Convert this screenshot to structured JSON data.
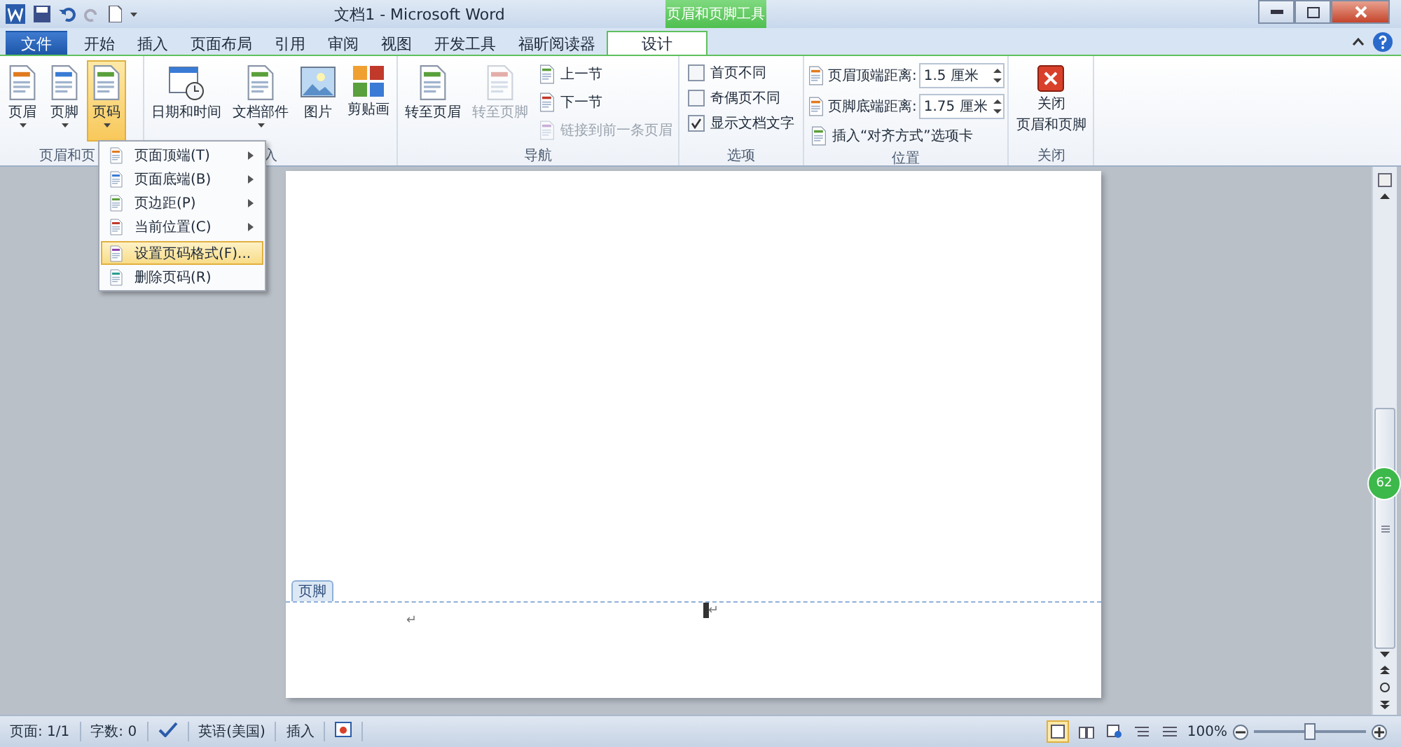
{
  "window": {
    "title": "文档1 - Microsoft Word",
    "contextual_header": "页眉和页脚工具"
  },
  "tabs": [
    {
      "label": "文件",
      "kind": "file",
      "selected": false
    },
    {
      "label": "开始",
      "kind": "tab",
      "selected": false
    },
    {
      "label": "插入",
      "kind": "tab",
      "selected": false
    },
    {
      "label": "页面布局",
      "kind": "tab",
      "selected": false
    },
    {
      "label": "引用",
      "kind": "tab",
      "selected": false
    },
    {
      "label": "审阅",
      "kind": "tab",
      "selected": false
    },
    {
      "label": "视图",
      "kind": "tab",
      "selected": false
    },
    {
      "label": "开发工具",
      "kind": "tab",
      "selected": false
    },
    {
      "label": "福昕阅读器",
      "kind": "tab",
      "selected": false
    },
    {
      "label": "设计",
      "kind": "contextual",
      "selected": true
    }
  ],
  "ribbon": {
    "groups": [
      {
        "label": "页眉和页",
        "items": [
          {
            "kind": "large",
            "label": "页眉",
            "dropdown": true,
            "selected": false,
            "disabled": false
          },
          {
            "kind": "large",
            "label": "页脚",
            "dropdown": true,
            "selected": false,
            "disabled": false
          },
          {
            "kind": "large",
            "label": "页码",
            "dropdown": true,
            "selected": true,
            "disabled": false
          }
        ]
      },
      {
        "label": "入",
        "items": [
          {
            "kind": "large",
            "label": "日期和时间",
            "dropdown": false,
            "selected": false,
            "disabled": false
          },
          {
            "kind": "large",
            "label": "文档部件",
            "dropdown": true,
            "selected": false,
            "disabled": false
          },
          {
            "kind": "large",
            "label": "图片",
            "dropdown": false,
            "selected": false,
            "disabled": false
          },
          {
            "kind": "large",
            "label": "剪贴画",
            "dropdown": false,
            "selected": false,
            "disabled": false
          }
        ]
      },
      {
        "label": "导航",
        "items": [
          {
            "kind": "large",
            "label": "转至页眉",
            "dropdown": false,
            "selected": false,
            "disabled": false
          },
          {
            "kind": "large",
            "label": "转至页脚",
            "dropdown": false,
            "selected": false,
            "disabled": true
          },
          {
            "kind": "small",
            "label": "上一节",
            "disabled": false
          },
          {
            "kind": "small",
            "label": "下一节",
            "disabled": false
          },
          {
            "kind": "small",
            "label": "链接到前一条页眉",
            "disabled": true
          }
        ]
      },
      {
        "label": "选项",
        "items": [
          {
            "kind": "checkbox",
            "label": "首页不同",
            "checked": false
          },
          {
            "kind": "checkbox",
            "label": "奇偶页不同",
            "checked": false
          },
          {
            "kind": "checkbox",
            "label": "显示文档文字",
            "checked": true
          }
        ]
      },
      {
        "label": "位置",
        "items": [
          {
            "kind": "spin",
            "label": "页眉顶端距离:",
            "value": "1.5 厘米"
          },
          {
            "kind": "spin",
            "label": "页脚底端距离:",
            "value": "1.75 厘米"
          },
          {
            "kind": "small",
            "label": "插入“对齐方式”选项卡",
            "disabled": false
          }
        ]
      },
      {
        "label": "关闭",
        "items": [
          {
            "kind": "close",
            "lines": [
              "关闭",
              "页眉和页脚"
            ]
          }
        ]
      }
    ]
  },
  "menu": {
    "items": [
      {
        "label": "页面顶端(T)",
        "submenu": true,
        "selected": false,
        "separator_before": false
      },
      {
        "label": "页面底端(B)",
        "submenu": true,
        "selected": false,
        "separator_before": false
      },
      {
        "label": "页边距(P)",
        "submenu": true,
        "selected": false,
        "separator_before": false
      },
      {
        "label": "当前位置(C)",
        "submenu": true,
        "selected": false,
        "separator_before": false
      },
      {
        "label": "设置页码格式(F)...",
        "submenu": false,
        "selected": true,
        "separator_before": true
      },
      {
        "label": "删除页码(R)",
        "submenu": false,
        "selected": false,
        "separator_before": false
      }
    ]
  },
  "document": {
    "footer_label": "页脚",
    "marks": [
      "↵",
      "↵"
    ]
  },
  "badge": "62",
  "status_bar": {
    "items": [
      "页面: 1/1",
      "字数: 0",
      "英语(美国)",
      "插入"
    ],
    "zoom": "100%",
    "zoom_level": {
      "level": 0.5
    }
  }
}
